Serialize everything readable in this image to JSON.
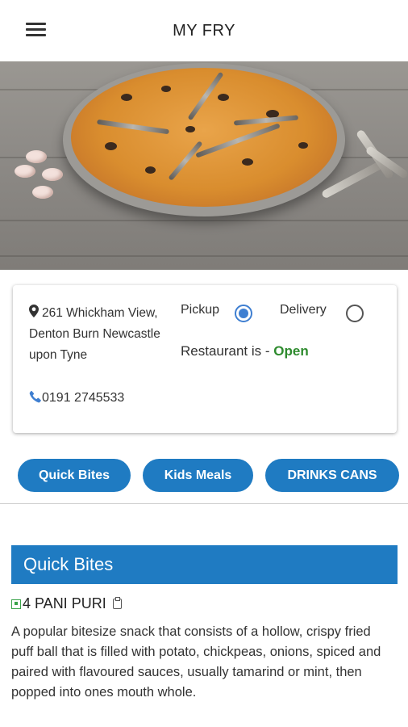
{
  "app_bar": {
    "title": "MY FRY",
    "menu_icon": "hamburger-menu-icon"
  },
  "hero": {
    "image_subject": "pizza-photo"
  },
  "restaurant": {
    "address_line1": "261 Whickham View, Denton Burn Newcastle upon Tyne",
    "phone": "0191 2745533",
    "status_label": "Restaurant is - ",
    "status_value": "Open",
    "status_color": "#2e8b2e"
  },
  "order_options": [
    {
      "label": "Pickup",
      "selected": true
    },
    {
      "label": "Delivery",
      "selected": false
    }
  ],
  "categories": [
    {
      "label": "Quick Bites"
    },
    {
      "label": "Kids Meals"
    },
    {
      "label": "DRINKS CANS"
    }
  ],
  "section": {
    "title": "Quick Bites"
  },
  "item": {
    "name": "4 PANI PURI",
    "description": "A popular bitesize snack that consists of a hollow, crispy fried puff ball that is filled with potato, chickpeas, onions, spiced and paired with flavoured sauces, usually tamarind or mint, then popped into ones mouth whole."
  },
  "colors": {
    "accent": "#1f7bc2",
    "radio_selected": "#3f7fd1"
  }
}
